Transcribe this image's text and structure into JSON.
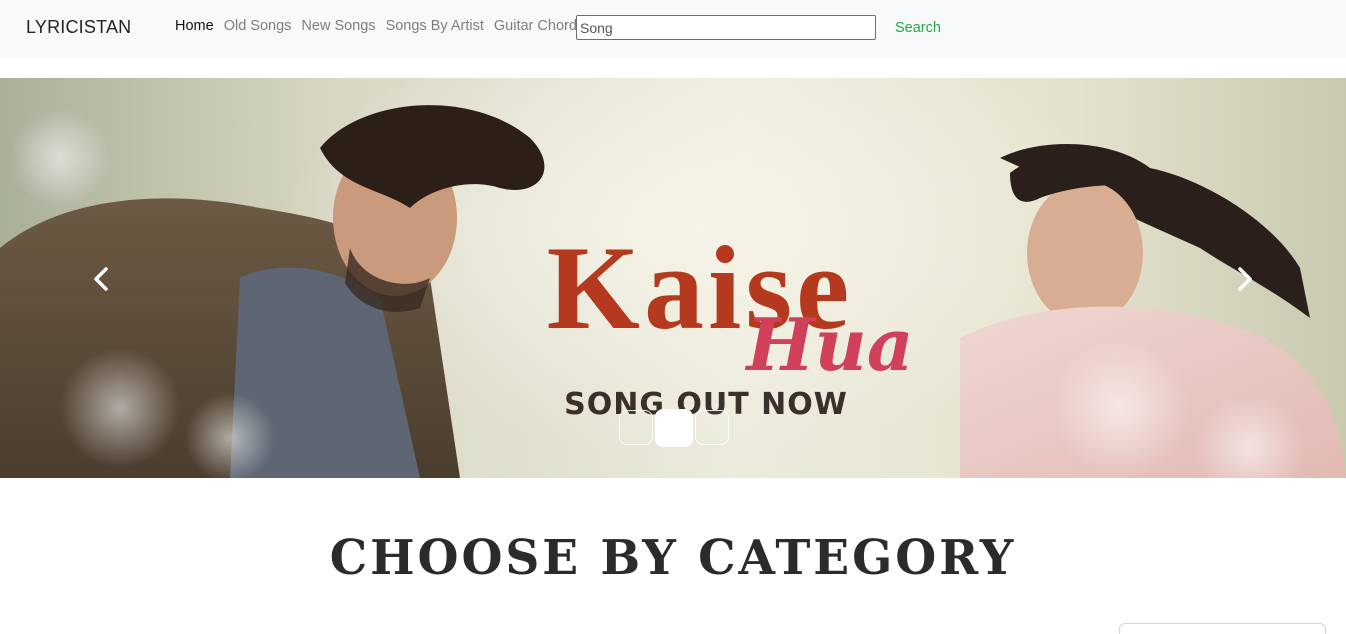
{
  "navbar": {
    "brand": "LYRICISTAN",
    "links": [
      {
        "label": "Home",
        "active": true
      },
      {
        "label": "Old Songs",
        "active": false
      },
      {
        "label": "New Songs",
        "active": false
      },
      {
        "label": "Songs By Artist",
        "active": false
      },
      {
        "label": "Guitar Chords",
        "active": false
      }
    ],
    "search": {
      "value": "Song",
      "placeholder": "Song",
      "button_label": "Search"
    }
  },
  "carousel": {
    "slide": {
      "title": "Kaise",
      "title_script": "Hua",
      "tagline": "SONG OUT NOW"
    },
    "controls": {
      "prev_icon": "chevron-left-icon",
      "next_icon": "chevron-right-icon"
    },
    "indicators": {
      "count": 3,
      "active_index": 1
    }
  },
  "main": {
    "section_title": "CHOOSE BY CATEGORY"
  },
  "colors": {
    "navbar_bg": "#f8f9fa",
    "search_button": "#28a745",
    "title_red": "#b5391f",
    "script_red": "#d0405a"
  }
}
